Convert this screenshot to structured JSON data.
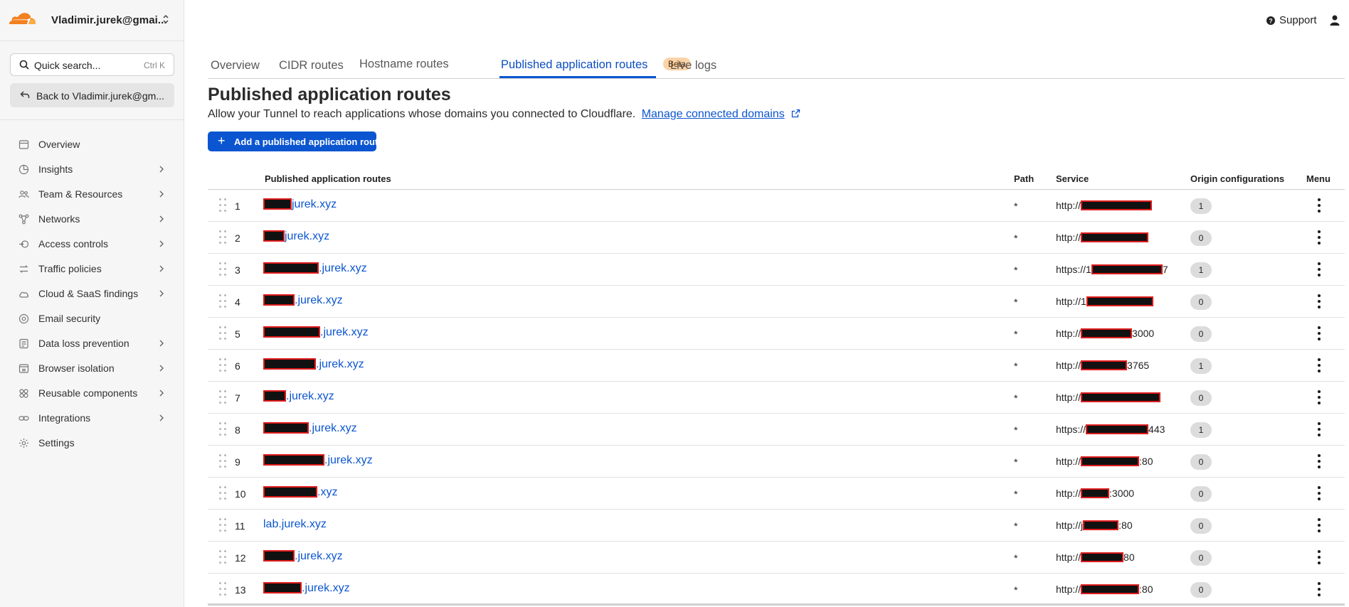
{
  "account": {
    "name": "Vladimir.jurek@gmai...",
    "switch_glyph": "⌃⌄"
  },
  "search": {
    "placeholder": "Quick search...",
    "shortcut": "Ctrl K"
  },
  "back": {
    "label": "Back to Vladimir.jurek@gm..."
  },
  "nav": [
    {
      "label": "Overview",
      "icon": "overview-icon",
      "chevron": false
    },
    {
      "label": "Insights",
      "icon": "insights-icon",
      "chevron": true
    },
    {
      "label": "Team & Resources",
      "icon": "team-icon",
      "chevron": true
    },
    {
      "label": "Networks",
      "icon": "networks-icon",
      "chevron": true
    },
    {
      "label": "Access controls",
      "icon": "access-icon",
      "chevron": true
    },
    {
      "label": "Traffic policies",
      "icon": "traffic-icon",
      "chevron": true
    },
    {
      "label": "Cloud & SaaS findings",
      "icon": "cloud-icon",
      "chevron": true
    },
    {
      "label": "Email security",
      "icon": "email-icon",
      "chevron": false
    },
    {
      "label": "Data loss prevention",
      "icon": "dlp-icon",
      "chevron": true
    },
    {
      "label": "Browser isolation",
      "icon": "browser-icon",
      "chevron": true
    },
    {
      "label": "Reusable components",
      "icon": "components-icon",
      "chevron": true
    },
    {
      "label": "Integrations",
      "icon": "integrations-icon",
      "chevron": true
    },
    {
      "label": "Settings",
      "icon": "settings-icon",
      "chevron": false
    }
  ],
  "header": {
    "support_label": "Support"
  },
  "tabs": {
    "overview": "Overview",
    "cidr": "CIDR routes",
    "hostname": "Hostname routes",
    "beta": "Beta",
    "published": "Published application routes",
    "live_logs": "Live logs"
  },
  "page": {
    "title": "Published application routes",
    "description": "Allow your Tunnel to reach applications whose domains you connected to Cloudflare.",
    "link": "Manage connected domains",
    "add_button": "Add a published application route"
  },
  "table": {
    "headers": {
      "routes": "Published application routes",
      "path": "Path",
      "service": "Service",
      "origin": "Origin configurations",
      "menu": "Menu"
    },
    "rows": [
      {
        "num": "1",
        "host_suffix": "jurek.xyz",
        "path": "*",
        "svc_prefix": "http://",
        "svc_suffix": "",
        "origin": "1"
      },
      {
        "num": "2",
        "host_suffix": "jurek.xyz",
        "path": "*",
        "svc_prefix": "http://",
        "svc_suffix": "",
        "origin": "0"
      },
      {
        "num": "3",
        "host_suffix": ".jurek.xyz",
        "path": "*",
        "svc_prefix": "https://1",
        "svc_suffix": "7",
        "origin": "1"
      },
      {
        "num": "4",
        "host_suffix": ".jurek.xyz",
        "path": "*",
        "svc_prefix": "http://1",
        "svc_suffix": "",
        "origin": "0"
      },
      {
        "num": "5",
        "host_suffix": ".jurek.xyz",
        "path": "*",
        "svc_prefix": "http://",
        "svc_suffix": "3000",
        "origin": "0"
      },
      {
        "num": "6",
        "host_suffix": ".jurek.xyz",
        "path": "*",
        "svc_prefix": "http://",
        "svc_suffix": "3765",
        "origin": "1"
      },
      {
        "num": "7",
        "host_suffix": ".jurek.xyz",
        "path": "*",
        "svc_prefix": "http://",
        "svc_suffix": "",
        "origin": "0"
      },
      {
        "num": "8",
        "host_suffix": ".jurek.xyz",
        "path": "*",
        "svc_prefix": "https://",
        "svc_suffix": "443",
        "origin": "1"
      },
      {
        "num": "9",
        "host_suffix": ".jurek.xyz",
        "path": "*",
        "svc_prefix": "http://",
        "svc_suffix": ":80",
        "origin": "0"
      },
      {
        "num": "10",
        "host_suffix": ".xyz",
        "path": "*",
        "svc_prefix": "http://",
        "svc_suffix": ":3000",
        "origin": "0"
      },
      {
        "num": "11",
        "host": "lab.jurek.xyz",
        "path": "*",
        "svc_prefix": "http://j",
        "svc_suffix": ":80",
        "origin": "0"
      },
      {
        "num": "12",
        "host_suffix": ".jurek.xyz",
        "path": "*",
        "svc_prefix": "http://",
        "svc_suffix": "80",
        "origin": "0"
      },
      {
        "num": "13",
        "host_suffix": ".jurek.xyz",
        "path": "*",
        "svc_prefix": "http://",
        "svc_suffix": ":80",
        "origin": "0"
      }
    ]
  },
  "colors": {
    "accent": "#0b55d0",
    "brand_orange": "#f38020",
    "redaction": "#e01b1b"
  }
}
